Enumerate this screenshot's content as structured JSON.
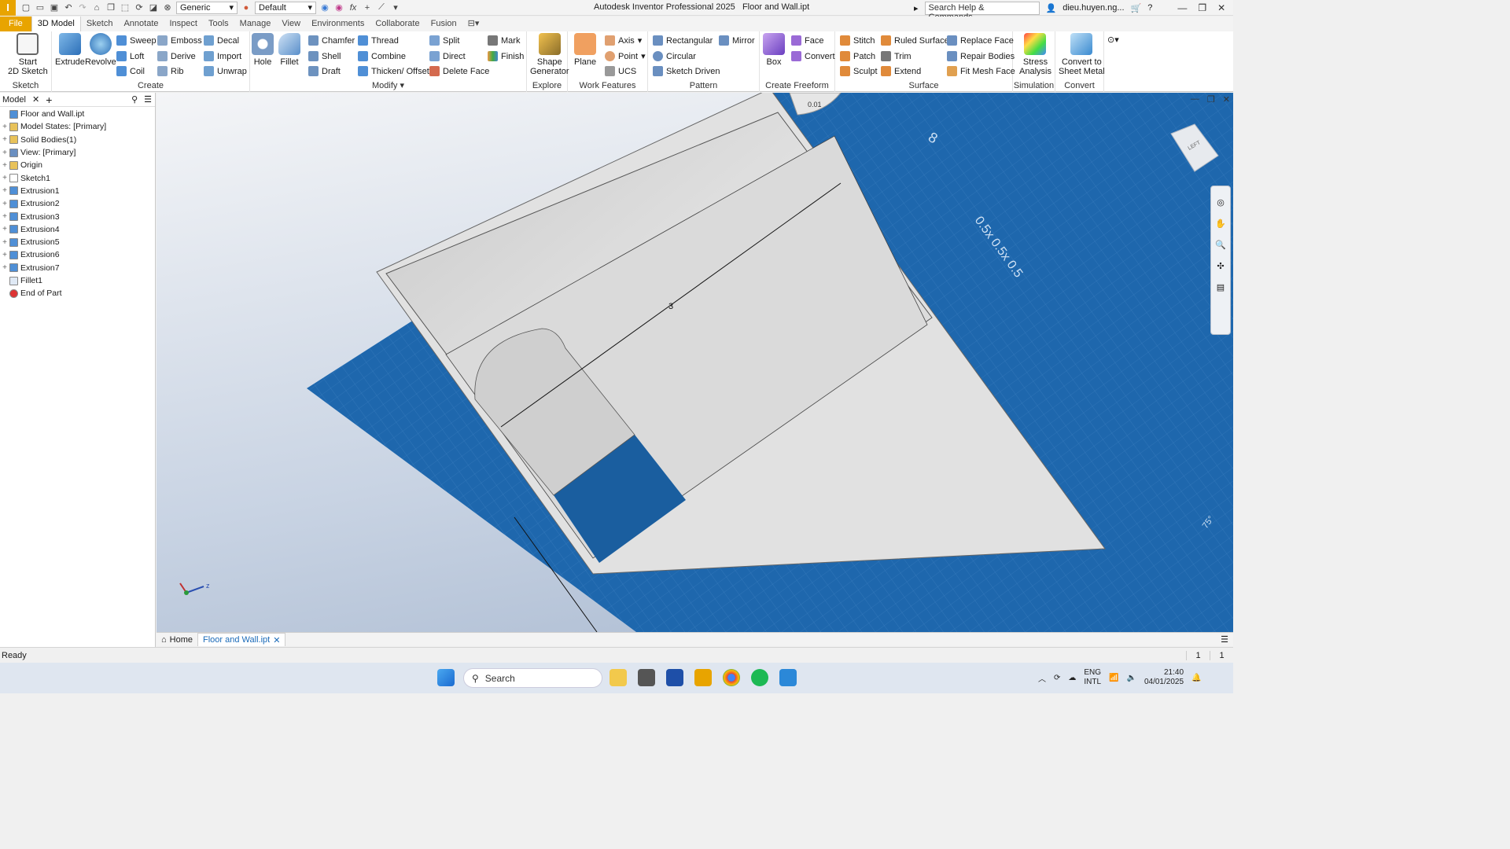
{
  "app": {
    "title": "Autodesk Inventor Professional 2025",
    "document": "Floor and Wall.ipt",
    "logo_letter": "I",
    "material": "Generic",
    "appearance": "Default",
    "help_search": "Search Help & Commands...",
    "user": "dieu.huyen.ng..."
  },
  "tabs": [
    "File",
    "3D Model",
    "Sketch",
    "Annotate",
    "Inspect",
    "Tools",
    "Manage",
    "View",
    "Environments",
    "Collaborate",
    "Fusion"
  ],
  "ribbon": {
    "sketch": {
      "title": "Sketch",
      "start": "Start\n2D Sketch"
    },
    "create": {
      "title": "Create",
      "extrude": "Extrude",
      "revolve": "Revolve",
      "col1": [
        "Sweep",
        "Loft",
        "Coil"
      ],
      "col2": [
        "Emboss",
        "Derive",
        "Rib"
      ],
      "col3": [
        "Decal",
        "Import",
        "Unwrap"
      ]
    },
    "modify": {
      "title": "Modify",
      "hole": "Hole",
      "fillet": "Fillet",
      "col1": [
        "Chamfer",
        "Shell",
        "Draft"
      ],
      "col2": [
        "Thread",
        "Combine",
        "Thicken/ Offset"
      ],
      "col3": [
        "Split",
        "Direct",
        "Delete Face"
      ],
      "col4": [
        "Mark",
        "Finish"
      ]
    },
    "explore": {
      "title": "Explore",
      "shape": "Shape\nGenerator"
    },
    "work": {
      "title": "Work Features",
      "plane": "Plane",
      "col1": [
        "Axis",
        "Point",
        "UCS"
      ]
    },
    "pattern": {
      "title": "Pattern",
      "col1": [
        "Rectangular",
        "Circular",
        "Sketch Driven"
      ],
      "mirror": "Mirror"
    },
    "freeform": {
      "title": "Create Freeform",
      "box": "Box",
      "col1": [
        "Face",
        "Convert"
      ]
    },
    "surface": {
      "title": "Surface",
      "col1": [
        "Stitch",
        "Patch",
        "Sculpt"
      ],
      "col2": [
        "Ruled Surface",
        "Trim",
        "Extend"
      ],
      "col3": [
        "Replace Face",
        "Repair Bodies",
        "Fit Mesh Face"
      ]
    },
    "simulation": {
      "title": "Simulation",
      "stress": "Stress\nAnalysis"
    },
    "convert": {
      "title": "Convert",
      "sheet": "Convert to\nSheet Metal"
    }
  },
  "browser": {
    "tab": "Model",
    "items": [
      {
        "label": "Floor and Wall.ipt",
        "icon": "part-icon",
        "expand": false
      },
      {
        "label": "Model States: [Primary]",
        "icon": "folder-icon",
        "expand": true
      },
      {
        "label": "Solid Bodies(1)",
        "icon": "folder-icon",
        "expand": true
      },
      {
        "label": "View: [Primary]",
        "icon": "view-icon",
        "expand": true
      },
      {
        "label": "Origin",
        "icon": "folder-icon",
        "expand": true
      },
      {
        "label": "Sketch1",
        "icon": "sketch-icon",
        "expand": true
      },
      {
        "label": "Extrusion1",
        "icon": "extrusion-icon",
        "expand": true
      },
      {
        "label": "Extrusion2",
        "icon": "extrusion-icon",
        "expand": true
      },
      {
        "label": "Extrusion3",
        "icon": "extrusion-icon",
        "expand": true
      },
      {
        "label": "Extrusion4",
        "icon": "extrusion-icon",
        "expand": true
      },
      {
        "label": "Extrusion5",
        "icon": "extrusion-icon",
        "expand": true
      },
      {
        "label": "Extrusion6",
        "icon": "extrusion-icon",
        "expand": true
      },
      {
        "label": "Extrusion7",
        "icon": "extrusion-icon",
        "expand": true
      },
      {
        "label": "Fillet1",
        "icon": "fillet-icon",
        "expand": false
      },
      {
        "label": "End of Part",
        "icon": "end-icon",
        "expand": false
      }
    ]
  },
  "viewport": {
    "dimension": "3",
    "grid_label": "0.5x 0.5x 0.5",
    "angle_label": "0.01",
    "scale_label": "8",
    "corner_label": "75°"
  },
  "doc_tabs": {
    "home": "Home",
    "active": "Floor and Wall.ipt"
  },
  "status": {
    "text": "Ready",
    "count1": "1",
    "count2": "1"
  },
  "taskbar": {
    "search": "Search",
    "lang1": "ENG",
    "lang2": "INTL",
    "time": "21:40",
    "date": "04/01/2025"
  },
  "colors": {
    "accent": "#e8a400",
    "grid_blue": "#1e67ad",
    "wall_grey": "#d8d8d8"
  }
}
